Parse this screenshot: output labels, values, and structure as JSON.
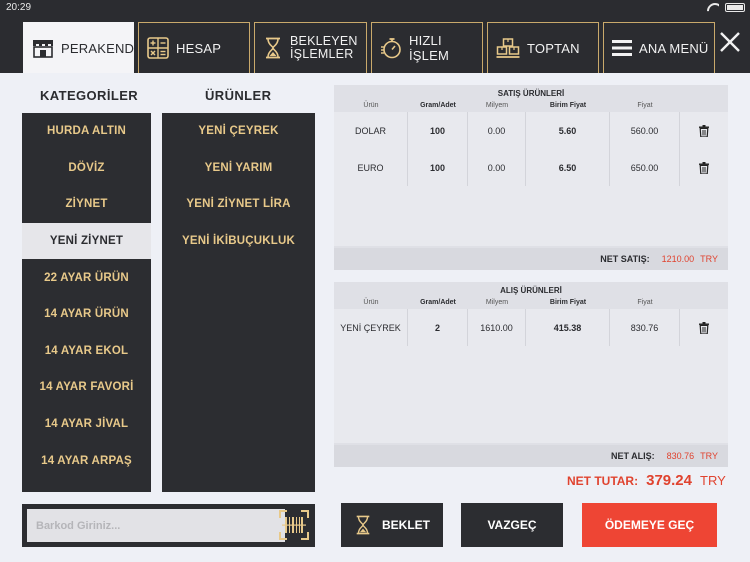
{
  "status": {
    "time": "20:29"
  },
  "tabs": [
    {
      "label": "PERAKENDE",
      "icon": "store-icon"
    },
    {
      "label": "HESAP",
      "icon": "calculator-icon"
    },
    {
      "label": "BEKLEYEN",
      "label2": "İŞLEMLER",
      "icon": "hourglass-icon"
    },
    {
      "label": "HIZLI İŞLEM",
      "icon": "stopwatch-icon"
    },
    {
      "label": "TOPTAN",
      "icon": "boxes-icon"
    },
    {
      "label": "ANA MENÜ",
      "icon": "menu-icon"
    }
  ],
  "categories": {
    "title": "KATEGORİLER",
    "items": [
      "HURDA ALTIN",
      "DÖVİZ",
      "ZİYNET",
      "YENİ ZİYNET",
      "22 AYAR ÜRÜN",
      "14 AYAR ÜRÜN",
      "14 AYAR EKOL",
      "14 AYAR FAVORİ",
      "14 AYAR JİVAL",
      "14 AYAR ARPAŞ"
    ],
    "selected": "YENİ ZİYNET"
  },
  "products": {
    "title": "ÜRÜNLER",
    "items": [
      "YENİ ÇEYREK",
      "YENİ YARIM",
      "YENİ ZİYNET LİRA",
      "YENİ İKİBUÇUKLUK"
    ]
  },
  "sales": {
    "title": "SATIŞ ÜRÜNLERİ",
    "columns": [
      "Ürün",
      "Gram/Adet",
      "Milyem",
      "Birim Fiyat",
      "Fiyat"
    ],
    "rows": [
      [
        "DOLAR",
        "100",
        "0.00",
        "5.60",
        "560.00"
      ],
      [
        "EURO",
        "100",
        "0.00",
        "6.50",
        "650.00"
      ]
    ],
    "net_label": "NET SATIŞ:",
    "net_value": "1210.00",
    "currency": "TRY"
  },
  "purchases": {
    "title": "ALIŞ ÜRÜNLERİ",
    "columns": [
      "Ürün",
      "Gram/Adet",
      "Milyem",
      "Birim Fiyat",
      "Fiyat"
    ],
    "rows": [
      [
        "YENİ ÇEYREK",
        "2",
        "1610.00",
        "415.38",
        "830.76"
      ]
    ],
    "net_label": "NET ALIŞ:",
    "net_value": "830.76",
    "currency": "TRY"
  },
  "total": {
    "label": "NET TUTAR:",
    "value": "379.24",
    "currency": "TRY"
  },
  "barcode": {
    "placeholder": "Barkod Giriniz..."
  },
  "actions": {
    "hold": "BEKLET",
    "cancel": "VAZGEÇ",
    "pay": "ÖDEMEYE GEÇ"
  },
  "colors": {
    "dark": "#2c2d31",
    "gold": "#e8c98a",
    "accent_red": "#ee4534"
  }
}
